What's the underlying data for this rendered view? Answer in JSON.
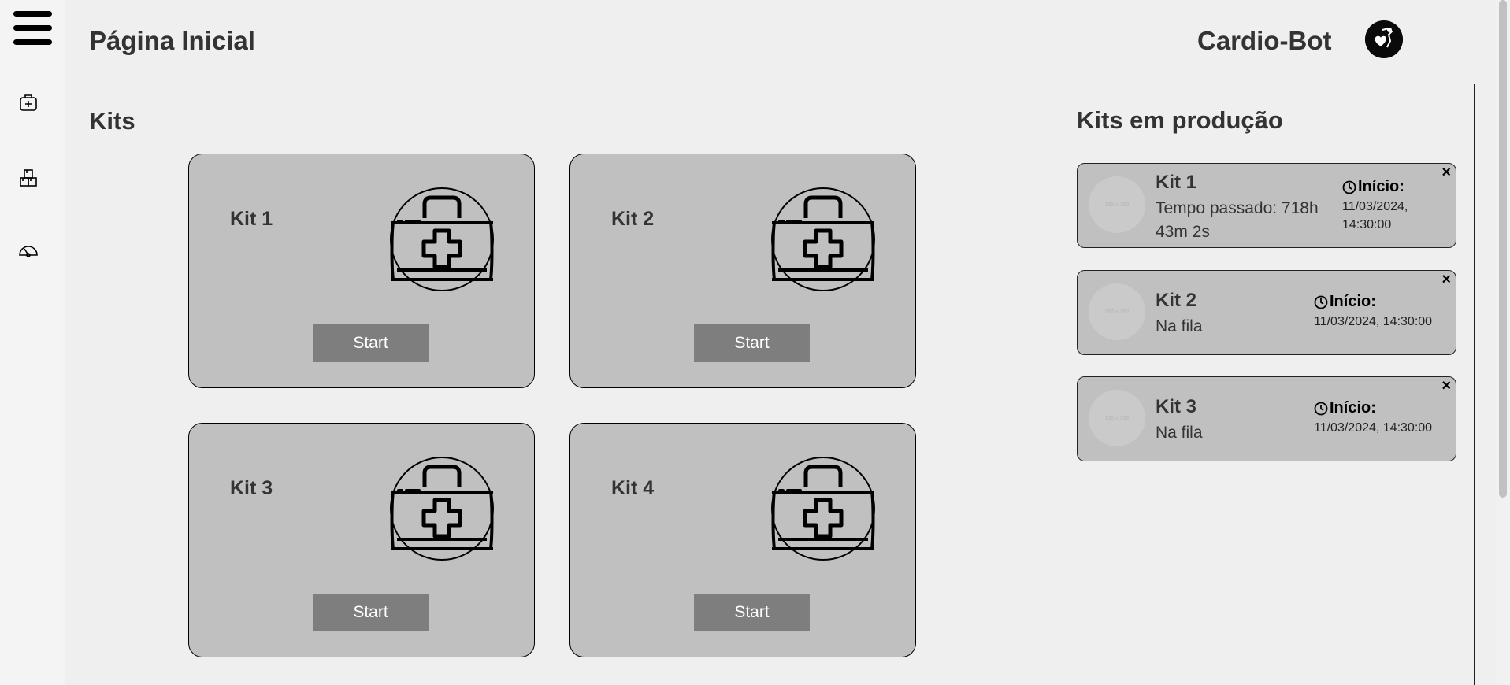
{
  "header": {
    "title": "Página Inicial",
    "brand": "Cardio-Bot"
  },
  "sidebar": {
    "items": [
      {
        "icon": "medical-bag-icon"
      },
      {
        "icon": "boxes-icon"
      },
      {
        "icon": "dashboard-gauge-icon"
      }
    ]
  },
  "kits": {
    "heading": "Kits",
    "items": [
      {
        "name": "Kit 1",
        "button": "Start",
        "icon": "first-aid-kit-icon"
      },
      {
        "name": "Kit 2",
        "button": "Start",
        "icon": "first-aid-kit-icon"
      },
      {
        "name": "Kit 3",
        "button": "Start",
        "icon": "first-aid-kit-icon"
      },
      {
        "name": "Kit 4",
        "button": "Start",
        "icon": "first-aid-kit-icon"
      }
    ]
  },
  "production": {
    "heading": "Kits em produção",
    "start_label": "Início:",
    "close": "×",
    "thumb_placeholder": "150 x 150",
    "items": [
      {
        "name": "Kit 1",
        "status": "Tempo passado: 718h 43m 2s",
        "start": "11/03/2024, 14:30:00"
      },
      {
        "name": "Kit 2",
        "status": "Na fila",
        "start": "11/03/2024, 14:30:00"
      },
      {
        "name": "Kit 3",
        "status": "Na fila",
        "start": "11/03/2024, 14:30:00"
      }
    ]
  },
  "colors": {
    "background": "#efefef",
    "card": "#c0c0c0",
    "button": "#7e7e7e",
    "text": "#333333"
  }
}
